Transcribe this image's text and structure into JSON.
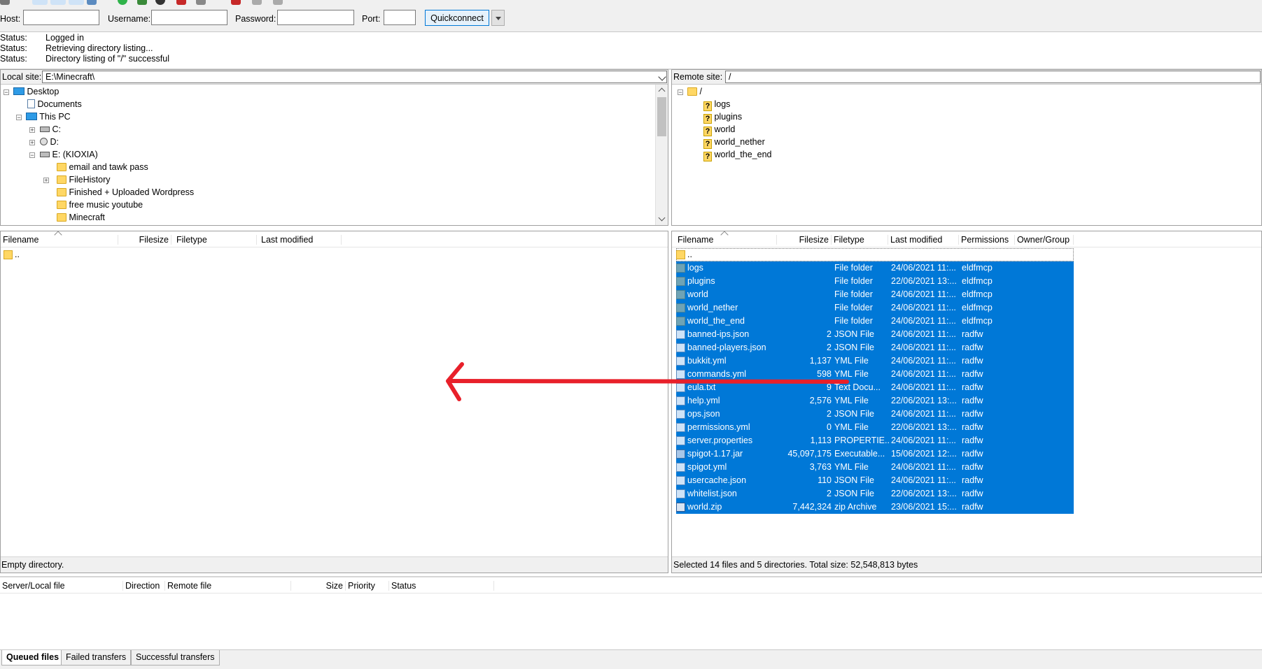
{
  "quickconnect": {
    "host_label": "Host:",
    "username_label": "Username:",
    "password_label": "Password:",
    "port_label": "Port:",
    "host_value": "",
    "username_value": "",
    "password_value": "",
    "port_value": "",
    "button_label": "Quickconnect"
  },
  "log": [
    {
      "key": "Status:",
      "value": "Logged in"
    },
    {
      "key": "Status:",
      "value": "Retrieving directory listing..."
    },
    {
      "key": "Status:",
      "value": "Directory listing of \"/\" successful"
    }
  ],
  "local": {
    "site_label": "Local site:",
    "path": "E:\\Minecraft\\",
    "tree": [
      {
        "label": "Desktop",
        "icon": "desktop-icon"
      },
      {
        "label": "Documents",
        "icon": "documents-icon"
      },
      {
        "label": "This PC",
        "icon": "computer-icon"
      },
      {
        "label": "C:",
        "icon": "drive-icon"
      },
      {
        "label": "D:",
        "icon": "cd-drive-icon"
      },
      {
        "label": "E: (KIOXIA)",
        "icon": "drive-icon"
      },
      {
        "label": "email and tawk pass",
        "icon": "folder-icon"
      },
      {
        "label": "FileHistory",
        "icon": "folder-icon"
      },
      {
        "label": "Finished + Uploaded Wordpress",
        "icon": "folder-icon"
      },
      {
        "label": "free music youtube",
        "icon": "folder-icon"
      },
      {
        "label": "Minecraft",
        "icon": "folder-icon"
      }
    ],
    "columns": [
      "Filename",
      "Filesize",
      "Filetype",
      "Last modified"
    ],
    "files": [
      {
        "name": ".."
      }
    ],
    "status": "Empty directory."
  },
  "remote": {
    "site_label": "Remote site:",
    "path": "/",
    "tree": [
      {
        "label": "/",
        "icon": "folder-icon"
      },
      {
        "label": "logs",
        "icon": "unknown-folder-icon"
      },
      {
        "label": "plugins",
        "icon": "unknown-folder-icon"
      },
      {
        "label": "world",
        "icon": "unknown-folder-icon"
      },
      {
        "label": "world_nether",
        "icon": "unknown-folder-icon"
      },
      {
        "label": "world_the_end",
        "icon": "unknown-folder-icon"
      }
    ],
    "columns": [
      "Filename",
      "Filesize",
      "Filetype",
      "Last modified",
      "Permissions",
      "Owner/Group"
    ],
    "files": [
      {
        "name": "..",
        "size": "",
        "type": "",
        "modified": "",
        "perms": "",
        "owner": "",
        "kind": "up",
        "selected": false
      },
      {
        "name": "logs",
        "size": "",
        "type": "File folder",
        "modified": "24/06/2021 11:...",
        "perms": "eldfmcp",
        "owner": "",
        "kind": "folder",
        "selected": true
      },
      {
        "name": "plugins",
        "size": "",
        "type": "File folder",
        "modified": "22/06/2021 13:...",
        "perms": "eldfmcp",
        "owner": "",
        "kind": "folder",
        "selected": true
      },
      {
        "name": "world",
        "size": "",
        "type": "File folder",
        "modified": "24/06/2021 11:...",
        "perms": "eldfmcp",
        "owner": "",
        "kind": "folder",
        "selected": true
      },
      {
        "name": "world_nether",
        "size": "",
        "type": "File folder",
        "modified": "24/06/2021 11:...",
        "perms": "eldfmcp",
        "owner": "",
        "kind": "folder",
        "selected": true
      },
      {
        "name": "world_the_end",
        "size": "",
        "type": "File folder",
        "modified": "24/06/2021 11:...",
        "perms": "eldfmcp",
        "owner": "",
        "kind": "folder",
        "selected": true
      },
      {
        "name": "banned-ips.json",
        "size": "2",
        "type": "JSON File",
        "modified": "24/06/2021 11:...",
        "perms": "radfw",
        "owner": "",
        "kind": "file",
        "selected": true
      },
      {
        "name": "banned-players.json",
        "size": "2",
        "type": "JSON File",
        "modified": "24/06/2021 11:...",
        "perms": "radfw",
        "owner": "",
        "kind": "file",
        "selected": true
      },
      {
        "name": "bukkit.yml",
        "size": "1,137",
        "type": "YML File",
        "modified": "24/06/2021 11:...",
        "perms": "radfw",
        "owner": "",
        "kind": "file",
        "selected": true
      },
      {
        "name": "commands.yml",
        "size": "598",
        "type": "YML File",
        "modified": "24/06/2021 11:...",
        "perms": "radfw",
        "owner": "",
        "kind": "file",
        "selected": true
      },
      {
        "name": "eula.txt",
        "size": "9",
        "type": "Text Docu...",
        "modified": "24/06/2021 11:...",
        "perms": "radfw",
        "owner": "",
        "kind": "file",
        "selected": true
      },
      {
        "name": "help.yml",
        "size": "2,576",
        "type": "YML File",
        "modified": "22/06/2021 13:...",
        "perms": "radfw",
        "owner": "",
        "kind": "file",
        "selected": true
      },
      {
        "name": "ops.json",
        "size": "2",
        "type": "JSON File",
        "modified": "24/06/2021 11:...",
        "perms": "radfw",
        "owner": "",
        "kind": "file",
        "selected": true
      },
      {
        "name": "permissions.yml",
        "size": "0",
        "type": "YML File",
        "modified": "22/06/2021 13:...",
        "perms": "radfw",
        "owner": "",
        "kind": "file",
        "selected": true
      },
      {
        "name": "server.properties",
        "size": "1,113",
        "type": "PROPERTIE...",
        "modified": "24/06/2021 11:...",
        "perms": "radfw",
        "owner": "",
        "kind": "file",
        "selected": true
      },
      {
        "name": "spigot-1.17.jar",
        "size": "45,097,175",
        "type": "Executable...",
        "modified": "15/06/2021 12:...",
        "perms": "radfw",
        "owner": "",
        "kind": "exe",
        "selected": true
      },
      {
        "name": "spigot.yml",
        "size": "3,763",
        "type": "YML File",
        "modified": "24/06/2021 11:...",
        "perms": "radfw",
        "owner": "",
        "kind": "file",
        "selected": true
      },
      {
        "name": "usercache.json",
        "size": "110",
        "type": "JSON File",
        "modified": "24/06/2021 11:...",
        "perms": "radfw",
        "owner": "",
        "kind": "file",
        "selected": true
      },
      {
        "name": "whitelist.json",
        "size": "2",
        "type": "JSON File",
        "modified": "22/06/2021 13:...",
        "perms": "radfw",
        "owner": "",
        "kind": "file",
        "selected": true
      },
      {
        "name": "world.zip",
        "size": "7,442,324",
        "type": "zip Archive",
        "modified": "23/06/2021 15:...",
        "perms": "radfw",
        "owner": "",
        "kind": "zip",
        "selected": true
      }
    ],
    "status": "Selected 14 files and 5 directories. Total size: 52,548,813 bytes"
  },
  "queue": {
    "columns": [
      "Server/Local file",
      "Direction",
      "Remote file",
      "Size",
      "Priority",
      "Status"
    ],
    "tabs": [
      "Queued files",
      "Failed transfers",
      "Successful transfers"
    ]
  },
  "colors": {
    "selection": "#0078d7",
    "annotation_arrow": "#e8202a"
  }
}
